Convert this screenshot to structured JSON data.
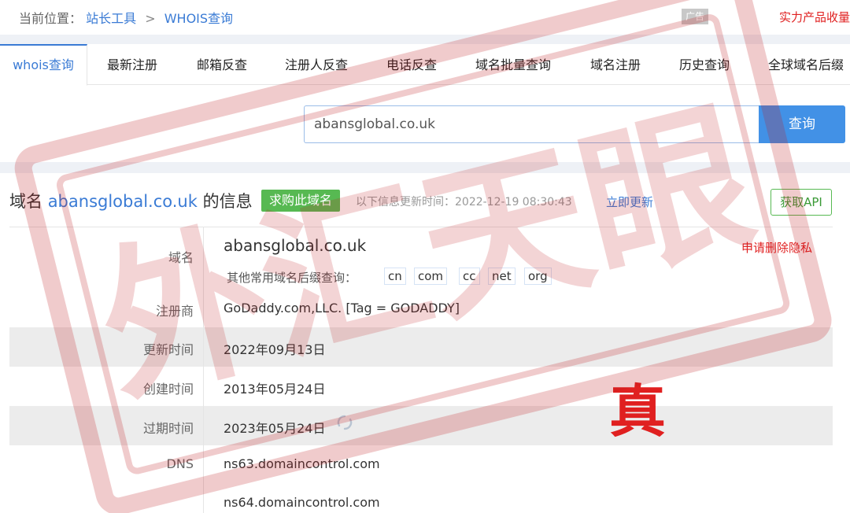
{
  "breadcrumb": {
    "prefix": "当前位置：",
    "tools": "站长工具",
    "separator": ">",
    "current": "WHOIS查询"
  },
  "ad": {
    "badge": "广告",
    "text": "实力产品收量"
  },
  "tabs": [
    {
      "label": "whois查询",
      "active": true
    },
    {
      "label": "最新注册"
    },
    {
      "label": "邮箱反查"
    },
    {
      "label": "注册人反查"
    },
    {
      "label": "电话反查"
    },
    {
      "label": "域名批量查询"
    },
    {
      "label": "域名注册"
    },
    {
      "label": "历史查询"
    },
    {
      "label": "全球域名后缀"
    }
  ],
  "search": {
    "value": "abansglobal.co.uk",
    "button": "查询"
  },
  "info": {
    "title_prefix": "域名",
    "title_domain": "abansglobal.co.uk",
    "title_suffix": "的信息",
    "buy_button": "求购此域名",
    "update_text": "以下信息更新时间：2022-12-19 08:30:43",
    "update_link": "立即更新",
    "api_button": "获取API"
  },
  "fields": {
    "domain_label": "域名",
    "domain_value": "abansglobal.co.uk",
    "privacy_link": "申请删除隐私",
    "suffix_label": "其他常用域名后缀查询：",
    "suffixes": [
      "cn",
      "com",
      "cc",
      "net",
      "org"
    ],
    "registrar_label": "注册商",
    "registrar_value": "GoDaddy.com,LLC. [Tag = GODADDY]",
    "updated_label": "更新时间",
    "updated_value": "2022年09月13日",
    "created_label": "创建时间",
    "created_value": "2013年05月24日",
    "expiry_label": "过期时间",
    "expiry_value": "2023年05月24日",
    "dns_label": "DNS",
    "dns_values": [
      "ns63.domaincontrol.com",
      "ns64.domaincontrol.com"
    ]
  },
  "overlay": {
    "stamp_char": "真",
    "watermark_text": "外汇天眼"
  },
  "colors": {
    "accent": "#3a7bd5",
    "green": "#57b952",
    "red": "#e02020",
    "button_blue": "#4291e6"
  }
}
